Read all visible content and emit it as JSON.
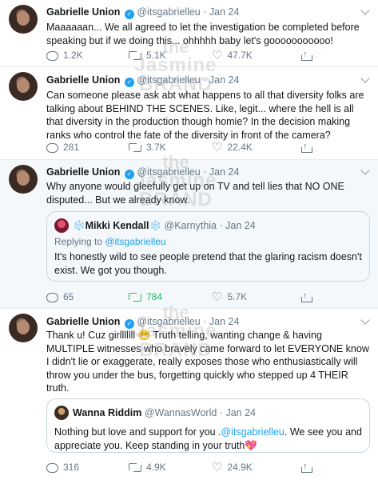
{
  "tweets": [
    {
      "name": "Gabrielle Union",
      "handle": "@itsgabrielleu",
      "dot": "·",
      "date": "Jan 24",
      "text": "Maaaaaan... We all agreed to let the investigation be completed before speaking but if we doing this... ohhhhh baby let's gooooooooooo!",
      "replies": "1.2K",
      "retweets": "5.1K",
      "likes": "47.7K"
    },
    {
      "name": "Gabrielle Union",
      "handle": "@itsgabrielleu",
      "dot": "·",
      "date": "Jan 24",
      "text": "Can someone please ask abt what happens to all that diversity folks are talking about BEHIND THE SCENES. Like, legit... where the hell is all that diversity in the production though homie? In the decision making ranks who control the fate of the diversity in front of the camera?",
      "replies": "281",
      "retweets": "3.7K",
      "likes": "22.4K"
    },
    {
      "name": "Gabrielle Union",
      "handle": "@itsgabrielleu",
      "dot": "·",
      "date": "Jan 24",
      "text": "Why anyone would gleefully get up on TV and tell lies that NO ONE disputed... But we already know.",
      "replies": "65",
      "retweets": "784",
      "likes": "5.7K",
      "quote": {
        "name": "❄️Mikki Kendall❄️",
        "handle": "@Karnythia",
        "dot": "·",
        "date": "Jan 24",
        "replying_prefix": "Replying to ",
        "replying_to": "@itsgabrielleu",
        "text": "It's honestly wild to see people pretend that the glaring racism doesn't exist. We got you though."
      }
    },
    {
      "name": "Gabrielle Union",
      "handle": "@itsgabrielleu",
      "dot": "·",
      "date": "Jan 24",
      "text_a": "Thank u! Cuz girlllllll ",
      "emoji": "😬",
      "text_b": " Truth telling, wanting change & having MULTIPLE witnesses who bravely came forward to let EVERYONE know I didn't lie or exaggerate, really exposes those who enthusiastically will throw you under the bus, forgetting quickly who stepped up 4 THEIR truth.",
      "replies": "316",
      "retweets": "4.9K",
      "likes": "24.9K",
      "quote": {
        "name": "Wanna Riddim",
        "handle": "@WannasWorld",
        "dot": "·",
        "date": "Jan 24",
        "text_a": "Nothing but love and support for you .",
        "mention": "@itsgabrielleu",
        "text_b": ". We see you and appreciate you. Keep standing in your truth",
        "emoji": "💖"
      }
    }
  ],
  "watermark": {
    "line1": "the",
    "line2": "Jasmine",
    "line3": "BRAND"
  },
  "icons": {
    "verified": "verified-badge-icon",
    "reply": "reply-icon",
    "retweet": "retweet-icon",
    "like": "heart-icon",
    "share": "share-icon"
  },
  "colors": {
    "accent": "#1da1f2",
    "retweeted": "#17bf63",
    "muted": "#657786",
    "border": "#e6ecf0"
  }
}
